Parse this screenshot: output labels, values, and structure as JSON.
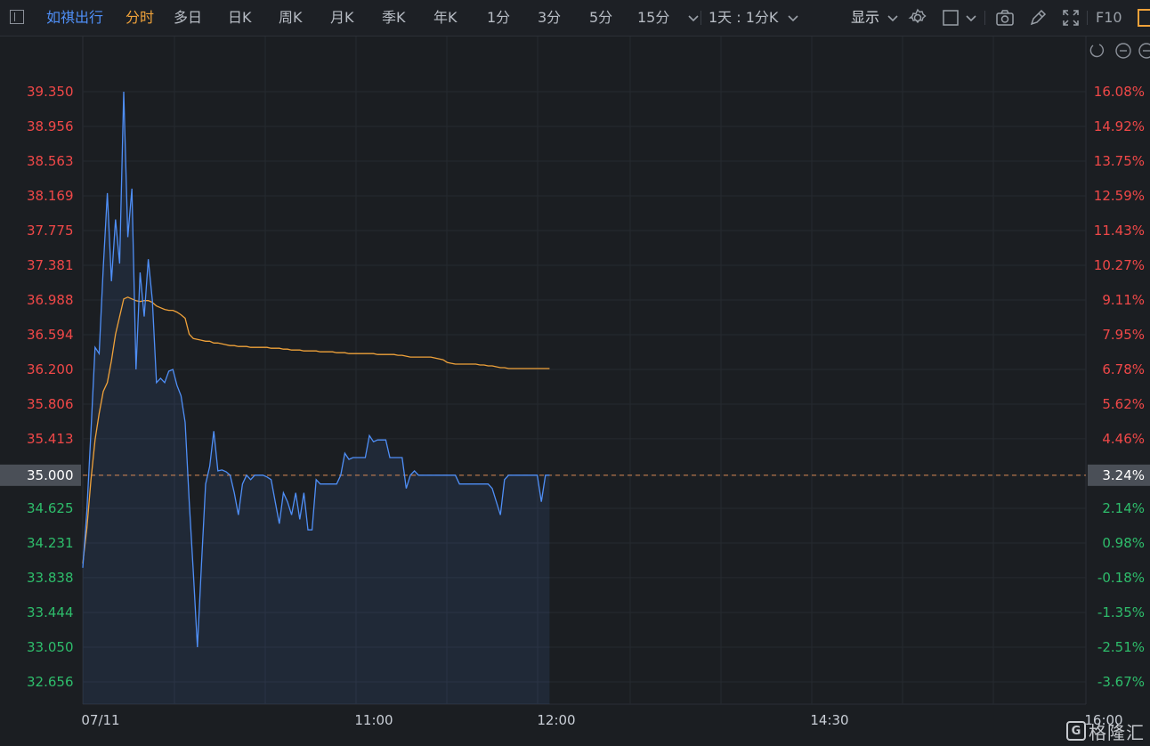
{
  "toolbar": {
    "symbol": "如祺出行",
    "periods": [
      "分时",
      "多日",
      "日K",
      "周K",
      "月K",
      "季K",
      "年K",
      "1分",
      "3分",
      "5分",
      "15分"
    ],
    "active_period": "分时",
    "interval": "1天 : 1分K",
    "display": "显示",
    "f10": "F10"
  },
  "colors": {
    "background": "#1b1e22",
    "price_line": "#4f8ff7",
    "avg_line": "#f0a23a",
    "up": "#f04848",
    "down": "#2ebd6b",
    "baseline_label_bg": "#4a4f57"
  },
  "logo": {
    "mark": "G",
    "text": "格隆汇"
  },
  "chart_data": {
    "type": "line",
    "title": "",
    "date_label": "07/11",
    "x_ticks": [
      "07/11",
      "11:00",
      "12:00",
      "14:30",
      "16:00"
    ],
    "y_left_ticks": [
      "39.350",
      "38.956",
      "38.563",
      "38.169",
      "37.775",
      "37.381",
      "36.988",
      "36.594",
      "36.200",
      "35.806",
      "35.413",
      "35.000",
      "34.625",
      "34.231",
      "33.838",
      "33.444",
      "33.050",
      "32.656"
    ],
    "y_right_ticks": [
      "16.08%",
      "14.92%",
      "13.75%",
      "12.59%",
      "11.43%",
      "10.27%",
      "9.11%",
      "7.95%",
      "6.78%",
      "5.62%",
      "4.46%",
      "3.24%",
      "2.14%",
      "0.98%",
      "-0.18%",
      "-1.35%",
      "-2.51%",
      "-3.67%"
    ],
    "ylim": [
      32.656,
      39.35
    ],
    "baseline": 35.0,
    "series": [
      {
        "key": "price",
        "x_minutes": [
          0,
          1,
          2,
          3,
          4,
          5,
          6,
          7,
          8,
          9,
          10,
          11,
          12,
          13,
          14,
          15,
          16,
          17,
          18,
          19,
          20,
          21,
          22,
          23,
          24,
          25,
          26,
          27,
          28,
          29,
          30,
          31,
          32,
          33,
          34,
          35,
          36,
          37,
          38,
          39,
          40,
          41,
          42,
          43,
          44,
          45,
          46,
          47,
          48,
          49,
          50,
          51,
          52,
          53,
          54,
          55,
          56,
          57,
          58,
          59,
          60,
          61,
          62,
          63,
          64,
          65,
          66,
          67,
          68,
          69,
          70,
          71,
          72,
          73,
          74,
          75,
          76,
          77,
          78,
          79,
          80,
          81,
          82,
          83,
          84,
          85,
          86,
          87,
          88,
          89,
          90,
          91,
          92,
          93,
          94,
          95,
          96,
          97,
          98,
          99,
          100,
          101,
          102,
          103,
          104,
          105,
          106,
          107,
          108,
          109,
          110,
          111,
          112,
          113,
          114,
          115,
          116,
          117,
          118,
          119,
          120,
          121,
          122,
          123,
          124,
          125,
          126,
          127,
          128,
          129,
          130,
          131,
          132,
          133,
          134,
          135,
          136,
          137,
          138,
          139,
          140,
          141,
          142,
          143,
          144,
          145,
          146,
          147,
          148,
          149,
          150
        ],
        "values": [
          33.95,
          34.6,
          35.5,
          36.45,
          36.38,
          37.35,
          38.2,
          37.2,
          37.9,
          37.4,
          39.35,
          37.7,
          38.25,
          36.2,
          37.3,
          36.8,
          37.45,
          36.98,
          36.05,
          36.1,
          36.05,
          36.18,
          36.2,
          36.02,
          35.9,
          35.6,
          34.7,
          33.9,
          33.05,
          34.0,
          34.9,
          35.1,
          35.5,
          35.05,
          35.06,
          35.04,
          35.0,
          34.8,
          34.55,
          34.9,
          35.0,
          34.95,
          35.0,
          35.0,
          35.0,
          34.98,
          34.95,
          34.7,
          34.45,
          34.8,
          34.7,
          34.55,
          34.8,
          34.5,
          34.8,
          34.38,
          34.38,
          34.95,
          34.9,
          34.9,
          34.9,
          34.9,
          34.9,
          35.0,
          35.25,
          35.18,
          35.2,
          35.2,
          35.2,
          35.2,
          35.45,
          35.38,
          35.4,
          35.4,
          35.4,
          35.2,
          35.2,
          35.2,
          35.2,
          34.85,
          35.0,
          35.05,
          35.0,
          35.0,
          35.0,
          35.0,
          35.0,
          35.0,
          35.0,
          35.0,
          35.0,
          35.0,
          34.9,
          34.9,
          34.9,
          34.9,
          34.9,
          34.9,
          34.9,
          34.9,
          34.85,
          34.7,
          34.55,
          34.95,
          35.0,
          35.0,
          35.0,
          35.0,
          35.0,
          35.0,
          35.0,
          35.0,
          34.7,
          35.0,
          35.0
        ]
      },
      {
        "key": "avg",
        "x_minutes": [
          0,
          1,
          2,
          3,
          4,
          5,
          6,
          7,
          8,
          9,
          10,
          11,
          12,
          13,
          14,
          15,
          16,
          17,
          18,
          19,
          20,
          21,
          22,
          23,
          24,
          25,
          26,
          27,
          28,
          29,
          30,
          31,
          32,
          33,
          34,
          35,
          36,
          37,
          38,
          39,
          40,
          41,
          42,
          43,
          44,
          45,
          46,
          47,
          48,
          49,
          50,
          51,
          52,
          53,
          54,
          55,
          56,
          57,
          58,
          59,
          60,
          61,
          62,
          63,
          64,
          65,
          66,
          67,
          68,
          69,
          70,
          71,
          72,
          73,
          74,
          75,
          76,
          77,
          78,
          79,
          80,
          81,
          82,
          83,
          84,
          85,
          86,
          87,
          88,
          89,
          90,
          91,
          92,
          93,
          94,
          95,
          96,
          97,
          98,
          99,
          100,
          101,
          102,
          103,
          104,
          105,
          106,
          107,
          108,
          109,
          110,
          111,
          112,
          113,
          114,
          115,
          116,
          117,
          118,
          119,
          120,
          121,
          122,
          123,
          124,
          125,
          126,
          127,
          128,
          129,
          130,
          131,
          132,
          133,
          134,
          135,
          136,
          137,
          138,
          139,
          140,
          141,
          142,
          143,
          144,
          145,
          146,
          147,
          148,
          149,
          150
        ],
        "values": [
          34.0,
          34.4,
          34.95,
          35.4,
          35.7,
          35.95,
          36.05,
          36.3,
          36.6,
          36.8,
          37.0,
          37.02,
          37.0,
          36.98,
          36.97,
          36.98,
          36.98,
          36.96,
          36.92,
          36.9,
          36.88,
          36.87,
          36.87,
          36.85,
          36.82,
          36.78,
          36.6,
          36.55,
          36.54,
          36.53,
          36.52,
          36.52,
          36.5,
          36.5,
          36.49,
          36.48,
          36.47,
          36.47,
          36.46,
          36.46,
          36.46,
          36.45,
          36.45,
          36.45,
          36.45,
          36.45,
          36.44,
          36.44,
          36.44,
          36.43,
          36.43,
          36.42,
          36.42,
          36.42,
          36.41,
          36.41,
          36.41,
          36.41,
          36.4,
          36.4,
          36.4,
          36.4,
          36.39,
          36.39,
          36.39,
          36.38,
          36.38,
          36.38,
          36.38,
          36.38,
          36.38,
          36.38,
          36.37,
          36.37,
          36.37,
          36.37,
          36.37,
          36.36,
          36.36,
          36.35,
          36.34,
          36.34,
          36.34,
          36.34,
          36.34,
          36.34,
          36.33,
          36.32,
          36.31,
          36.28,
          36.27,
          36.26,
          36.26,
          36.26,
          36.26,
          36.26,
          36.26,
          36.25,
          36.25,
          36.24,
          36.24,
          36.23,
          36.22,
          36.22,
          36.21,
          36.21,
          36.21,
          36.21,
          36.21,
          36.21,
          36.21,
          36.21,
          36.21,
          36.21,
          36.21
        ]
      }
    ]
  }
}
